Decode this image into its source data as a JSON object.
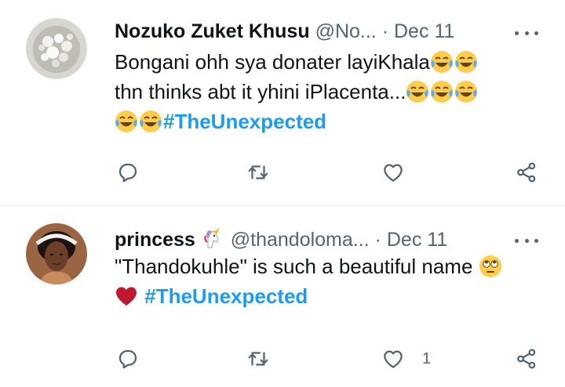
{
  "tweets": [
    {
      "name": "Nozuko Zuket Khusu",
      "handle": "@No...",
      "separator": "·",
      "date": "Dec 11",
      "line1_text": "Bongani ohh sya donater layiKhala",
      "line2_text": "thn thinks abt it yhini iPlacenta...",
      "hashtag": "#TheUnexpected",
      "line1_emojis": [
        "joy-emoji",
        "joy-emoji"
      ],
      "line2_emojis": [
        "joy-emoji",
        "joy-emoji",
        "joy-emoji"
      ],
      "line3_emojis": [
        "joy-emoji",
        "joy-emoji"
      ],
      "like_count": ""
    },
    {
      "name": "princess",
      "name_emoji": "unicorn-emoji",
      "handle": "@thandoloma...",
      "separator": "·",
      "date": "Dec 11",
      "line1_text": "\"Thandokuhle\" is such a beautiful name",
      "line1_emojis": [
        "rolling-eyes-emoji"
      ],
      "line2_emojis": [
        "red-heart-emoji"
      ],
      "hashtag": "#TheUnexpected",
      "like_count": "1"
    }
  ],
  "colors": {
    "text": "#0f1419",
    "secondary": "#536471",
    "hashtag": "#1d9bf0",
    "divider": "#e6ecf0"
  }
}
